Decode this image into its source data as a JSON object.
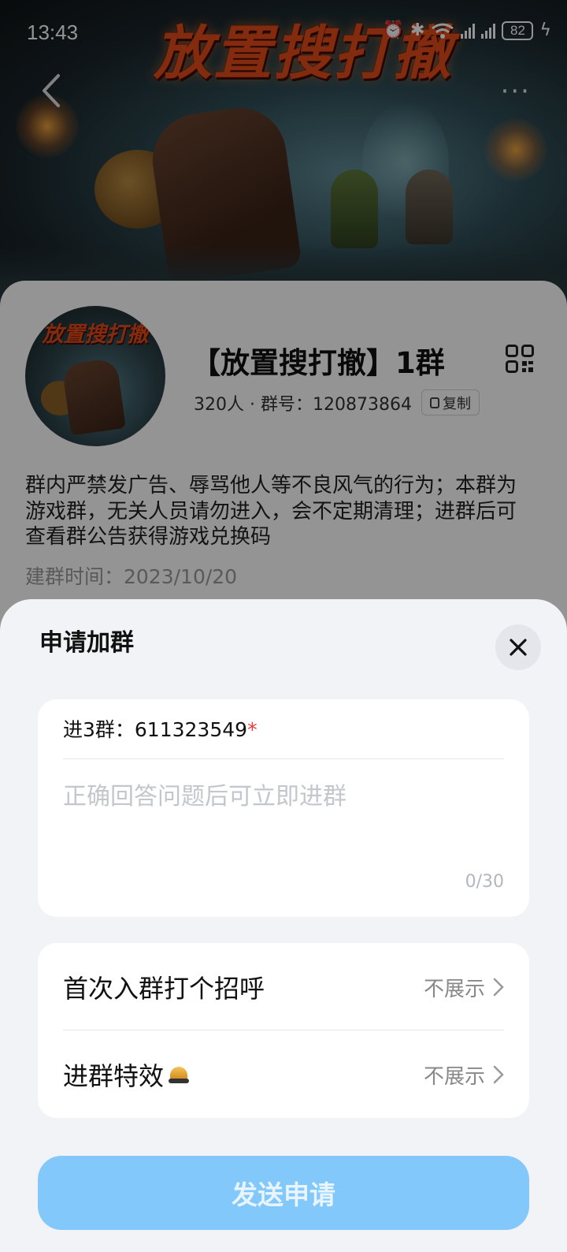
{
  "status_bar": {
    "time": "13:43",
    "battery": "82"
  },
  "banner": {
    "title": "放置搜打撤"
  },
  "group": {
    "avatar_title": "放置搜打撤",
    "name": "【放置搜打撤】1群",
    "meta": "320人 · 群号：120873864",
    "copy_label": "复制",
    "description": "群内严禁发广告、辱骂他人等不良风气的行为；本群为游戏群，无关人员请勿进入，会不定期清理；进群后可查看群公告获得游戏兑换码",
    "created": "建群时间：2023/10/20"
  },
  "sheet": {
    "title": "申请加群",
    "question": {
      "label": "进3群：611323549",
      "required_mark": "*",
      "placeholder": "正确回答问题后可立即进群",
      "counter": "0/30"
    },
    "options": [
      {
        "label": "首次入群打个招呼",
        "value": "不展示"
      },
      {
        "label": "进群特效",
        "value": "不展示"
      }
    ],
    "submit_label": "发送申请"
  },
  "colors": {
    "accent": "#82c8fb",
    "required": "#f03a3a",
    "sheet_bg": "#f2f3f7"
  },
  "icons": [
    "back-icon",
    "more-icon",
    "qr-code-icon",
    "copy-icon",
    "close-icon",
    "chevron-right-icon",
    "alarm-icon",
    "bluetooth-icon",
    "wifi-icon",
    "signal-icon",
    "battery-icon",
    "charging-icon",
    "effect-icon"
  ]
}
